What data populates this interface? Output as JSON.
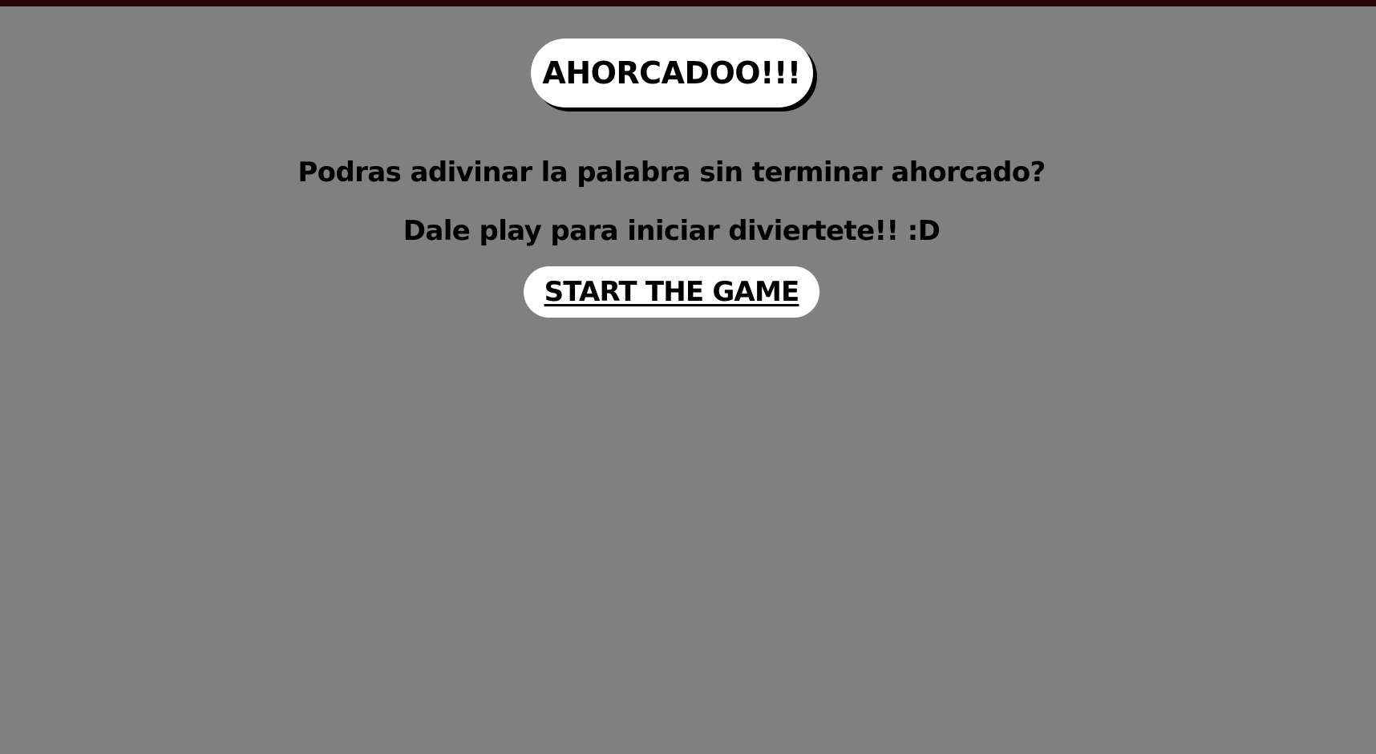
{
  "theme": {
    "background": "#808080",
    "top_bar": "#2a0505",
    "box_background": "#ffffff",
    "text": "#000000"
  },
  "header": {
    "title": "AHORCADOO!!!"
  },
  "intro": {
    "question": "Podras adivinar la palabra sin terminar ahorcado?",
    "instruction": "Dale play para iniciar diviertete!! :D"
  },
  "actions": {
    "start_label": "START THE GAME"
  }
}
